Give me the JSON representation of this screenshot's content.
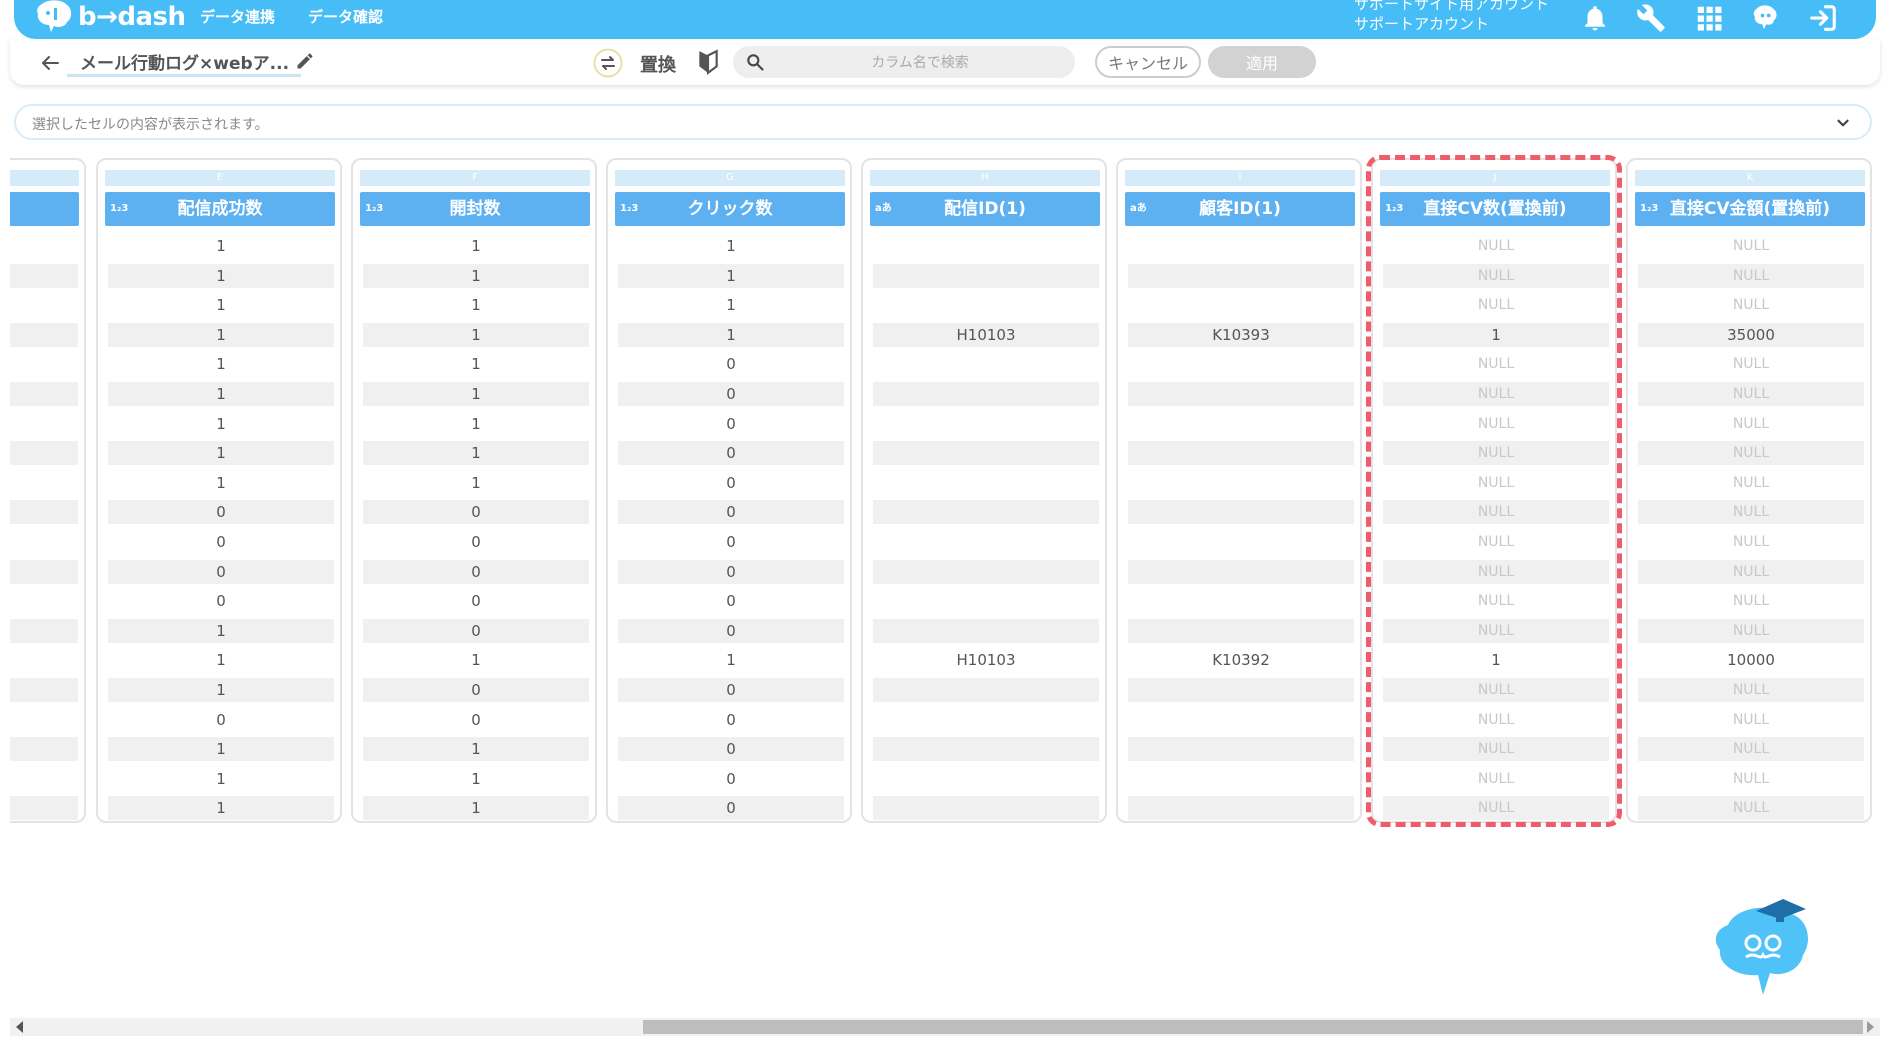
{
  "header": {
    "logo_text": "b→dash",
    "nav": [
      "データ連携",
      "データ確認"
    ],
    "user_line1": "サポートサイト用アカウント",
    "user_line2": "サポートアカウント",
    "icons": [
      "bell-icon",
      "wrench-icon",
      "apps-grid-icon",
      "brain-assistant-icon",
      "logout-icon"
    ],
    "bar_color": "#46bdf6"
  },
  "toolbar": {
    "title": "メール行動ログ×webア...",
    "swap_label": "置換",
    "search_placeholder": "カラム名で検索",
    "cancel_label": "キャンセル",
    "apply_label": "適用"
  },
  "cell_preview": {
    "placeholder": "選択したセルの内容が表示されます。"
  },
  "grid": {
    "header_color": "#5eb1f1",
    "highlight_color": "#ef5d6a",
    "columns": [
      {
        "letter": "E",
        "type": "1₂3",
        "name": "配信成功数",
        "cells": [
          "1",
          "1",
          "1",
          "1",
          "1",
          "1",
          "1",
          "1",
          "1",
          "0",
          "0",
          "0",
          "0",
          "1",
          "1",
          "1",
          "0",
          "1",
          "1",
          "1"
        ]
      },
      {
        "letter": "F",
        "type": "1₂3",
        "name": "開封数",
        "cells": [
          "1",
          "1",
          "1",
          "1",
          "1",
          "1",
          "1",
          "1",
          "1",
          "0",
          "0",
          "0",
          "0",
          "0",
          "1",
          "0",
          "0",
          "1",
          "1",
          "1"
        ]
      },
      {
        "letter": "G",
        "type": "1₂3",
        "name": "クリック数",
        "cells": [
          "1",
          "1",
          "1",
          "1",
          "0",
          "0",
          "0",
          "0",
          "0",
          "0",
          "0",
          "0",
          "0",
          "0",
          "1",
          "0",
          "0",
          "0",
          "0",
          "0"
        ]
      },
      {
        "letter": "H",
        "type": "aあ",
        "name": "配信ID(1)",
        "cells": [
          "",
          "",
          "",
          "H10103",
          "",
          "",
          "",
          "",
          "",
          "",
          "",
          "",
          "",
          "",
          "H10103",
          "",
          "",
          "",
          "",
          ""
        ]
      },
      {
        "letter": "I",
        "type": "aあ",
        "name": "顧客ID(1)",
        "cells": [
          "",
          "",
          "",
          "K10393",
          "",
          "",
          "",
          "",
          "",
          "",
          "",
          "",
          "",
          "",
          "K10392",
          "",
          "",
          "",
          "",
          ""
        ]
      },
      {
        "letter": "J",
        "type": "1₂3",
        "name": "直接CV数(置換前)",
        "cells": [
          "NULL",
          "NULL",
          "NULL",
          "1",
          "NULL",
          "NULL",
          "NULL",
          "NULL",
          "NULL",
          "NULL",
          "NULL",
          "NULL",
          "NULL",
          "NULL",
          "1",
          "NULL",
          "NULL",
          "NULL",
          "NULL",
          "NULL"
        ]
      },
      {
        "letter": "K",
        "type": "1₂3",
        "name": "直接CV金額(置換前)",
        "cells": [
          "NULL",
          "NULL",
          "NULL",
          "35000",
          "NULL",
          "NULL",
          "NULL",
          "NULL",
          "NULL",
          "NULL",
          "NULL",
          "NULL",
          "NULL",
          "NULL",
          "10000",
          "NULL",
          "NULL",
          "NULL",
          "NULL",
          "NULL"
        ]
      }
    ]
  }
}
